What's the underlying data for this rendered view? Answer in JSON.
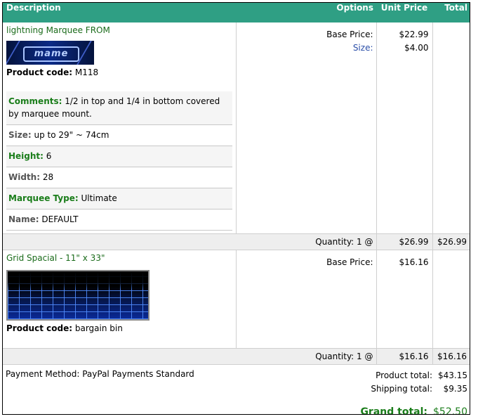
{
  "header": {
    "description": "Description",
    "options": "Options",
    "unit_price": "Unit Price",
    "total": "Total"
  },
  "items": [
    {
      "title": "lightning Marquee FROM",
      "image_icon": "mame-marquee-image",
      "image_text": "mame",
      "product_code_label": "Product code:",
      "product_code": "M118",
      "attributes": [
        {
          "label": "Comments:",
          "value": "1/2 in top and 1/4 in bottom covered by marquee mount."
        },
        {
          "label": "Size:",
          "value": "up to 29\" ~ 74cm"
        },
        {
          "label": "Height:",
          "value": "6"
        },
        {
          "label": "Width:",
          "value": "28"
        },
        {
          "label": "Marquee Type:",
          "value": "Ultimate"
        },
        {
          "label": "Name:",
          "value": "DEFAULT"
        }
      ],
      "options": [
        {
          "label": "Base Price:",
          "price": "$22.99"
        },
        {
          "label": "Size:",
          "price": "$4.00"
        }
      ],
      "quantity_label": "Quantity: 1 @",
      "unit_price": "$26.99",
      "line_total": "$26.99"
    },
    {
      "title": "Grid Spacial - 11\" x 33\"",
      "image_icon": "grid-spacial-image",
      "product_code_label": "Product code:",
      "product_code": "bargain bin",
      "options": [
        {
          "label": "Base Price:",
          "price": "$16.16"
        }
      ],
      "quantity_label": "Quantity: 1 @",
      "unit_price": "$16.16",
      "line_total": "$16.16"
    }
  ],
  "footer": {
    "payment_method": "Payment Method: PayPal Payments Standard",
    "product_total_label": "Product total:",
    "product_total": "$43.15",
    "shipping_total_label": "Shipping total:",
    "shipping_total": "$9.35",
    "grand_total_label": "Grand total:",
    "grand_total": "$52.50"
  },
  "colors": {
    "header_bg": "#2f9f84",
    "label_green": "#1a7d1a",
    "option_blue": "#2a4ea8"
  }
}
